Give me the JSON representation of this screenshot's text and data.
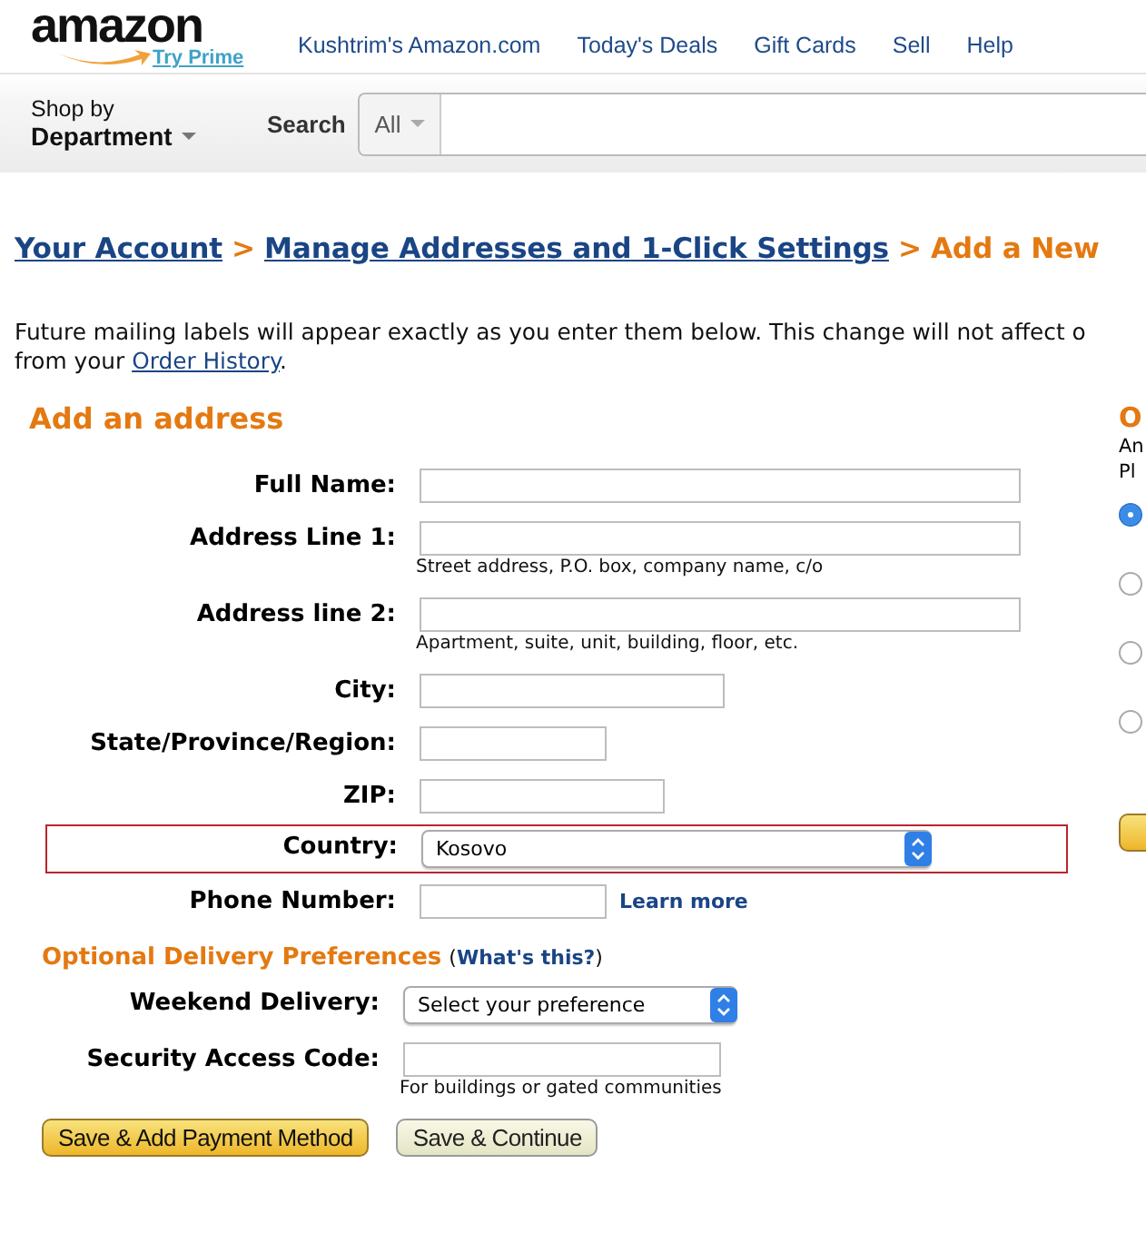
{
  "header": {
    "logo": "amazon",
    "prime_link": "Try Prime",
    "nav": [
      "Kushtrim's Amazon.com",
      "Today's Deals",
      "Gift Cards",
      "Sell",
      "Help"
    ],
    "department": {
      "small": "Shop by",
      "big": "Department"
    },
    "search": {
      "label": "Search",
      "category": "All"
    }
  },
  "breadcrumb": [
    {
      "text": "Your Account",
      "kind": "link"
    },
    {
      "text": ">",
      "kind": "sep"
    },
    {
      "text": "Manage Addresses and 1-Click Settings",
      "kind": "link"
    },
    {
      "text": ">",
      "kind": "sep"
    },
    {
      "text": "Add a New",
      "kind": "current"
    }
  ],
  "intro": {
    "line_1": "Future mailing labels will appear exactly as you enter them below. This change will not affect o",
    "line_2": "from your",
    "link": "Order History",
    "after": "."
  },
  "form": {
    "title": "Add an address",
    "fields": [
      {
        "label": "Full Name:",
        "kind": "long"
      },
      {
        "label": "Address Line 1:",
        "kind": "long",
        "hint": "Street address, P.O. box, company name, c/o"
      },
      {
        "label": "Address line 2:",
        "kind": "long",
        "hint": "Apartment, suite, unit, building, floor, etc."
      },
      {
        "label": "City:",
        "kind": "medium"
      },
      {
        "label": "State/Province/Region:",
        "kind": "short"
      },
      {
        "label": "ZIP:",
        "kind": "zip"
      },
      {
        "label": "Country:",
        "kind": "select",
        "value": "Kosovo",
        "highlighted": true
      },
      {
        "label": "Phone Number:",
        "kind": "short",
        "link": "Learn more"
      }
    ]
  },
  "optional": {
    "title": "Optional Delivery Preferences",
    "help_open": "(",
    "help_link": "What's this?",
    "help_close": ")",
    "fields": [
      {
        "label": "Weekend Delivery:",
        "kind": "select",
        "value": "Select your preference"
      },
      {
        "label": "Security Access Code:",
        "kind": "code",
        "hint": "For buildings or gated communities"
      }
    ]
  },
  "buttons": [
    {
      "label": "Save & Add Payment Method",
      "kind": "primary"
    },
    {
      "label": "Save & Continue",
      "kind": "secondary"
    }
  ],
  "side": {
    "heading": "O",
    "lines": [
      "An",
      "Pl"
    ],
    "options": [
      {
        "selected": true
      },
      {
        "selected": false
      },
      {
        "selected": false
      },
      {
        "selected": false
      }
    ]
  }
}
